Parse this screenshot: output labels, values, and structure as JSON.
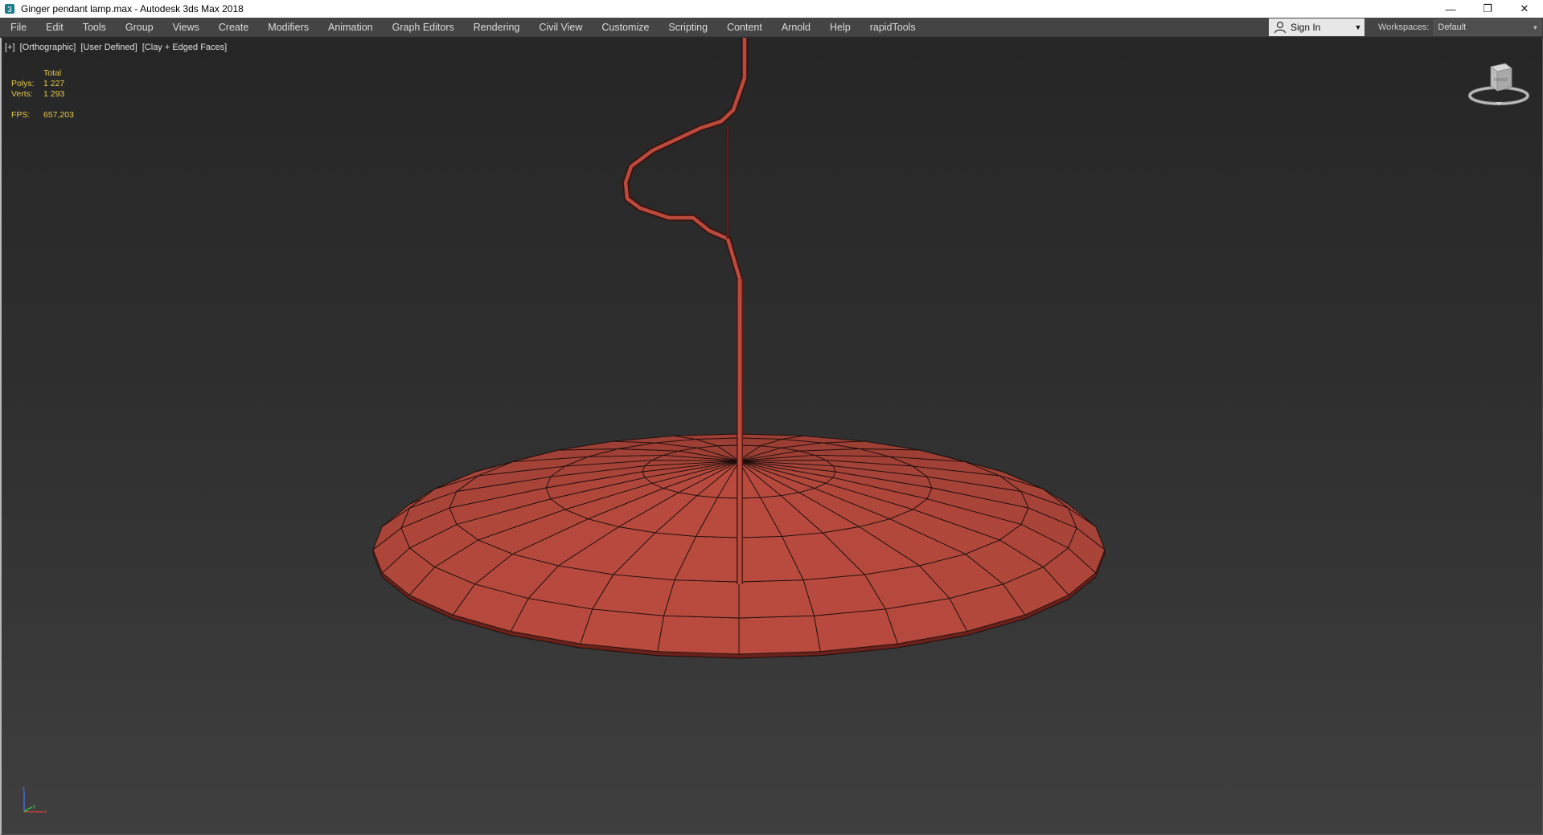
{
  "window": {
    "title": "Ginger pendant lamp.max - Autodesk 3ds Max 2018",
    "controls": [
      "—",
      "❐",
      "✕"
    ]
  },
  "menu": {
    "items": [
      "File",
      "Edit",
      "Tools",
      "Group",
      "Views",
      "Create",
      "Modifiers",
      "Animation",
      "Graph Editors",
      "Rendering",
      "Civil View",
      "Customize",
      "Scripting",
      "Content",
      "Arnold",
      "Help",
      "rapidTools"
    ],
    "signin_label": "Sign In",
    "workspaces_label": "Workspaces:",
    "workspace_value": "Default"
  },
  "viewport": {
    "labels": [
      "[+]",
      "[Orthographic]",
      "[User Defined]",
      "[Clay + Edged Faces]"
    ],
    "stats": {
      "total_label": "Total",
      "polys_label": "Polys:",
      "polys_value": "1 227",
      "verts_label": "Verts:",
      "verts_value": "1 293",
      "fps_label": "FPS:",
      "fps_value": "657,203"
    },
    "viewcube_face": "FRONT"
  },
  "colors": {
    "lamp_fill": "#b84a3e",
    "lamp_edge": "#1e0f0c",
    "stats_text": "#e3c94a"
  }
}
